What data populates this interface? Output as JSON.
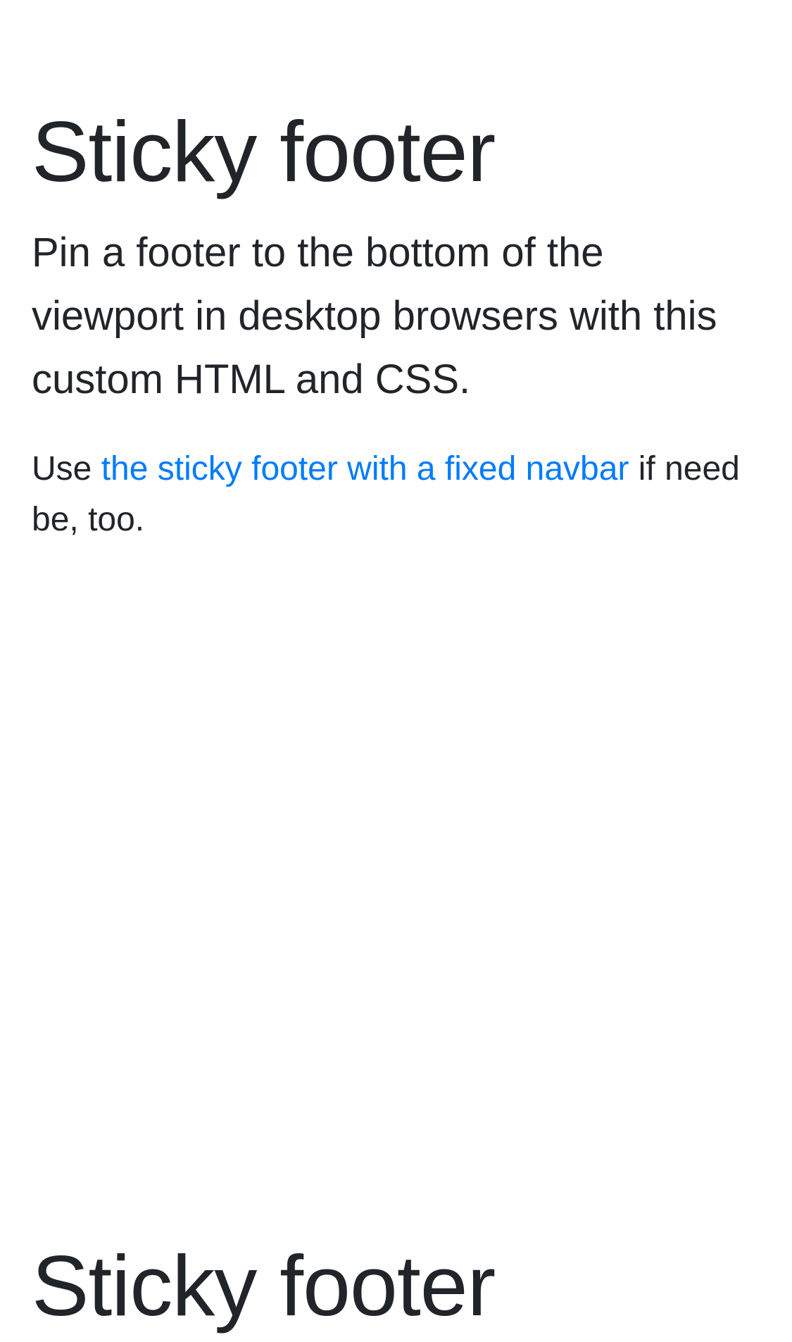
{
  "page": {
    "title": "Sticky footer",
    "lead": "Pin a footer to the bottom of the viewport in desktop browsers with this custom HTML and CSS.",
    "body": {
      "prefix": "Use ",
      "link_text": "the sticky footer with a fixed navbar",
      "suffix": " if need be, too."
    },
    "repeat_title": "Sticky footer"
  },
  "colors": {
    "text": "#212529",
    "link": "#007bff",
    "background": "#ffffff"
  }
}
